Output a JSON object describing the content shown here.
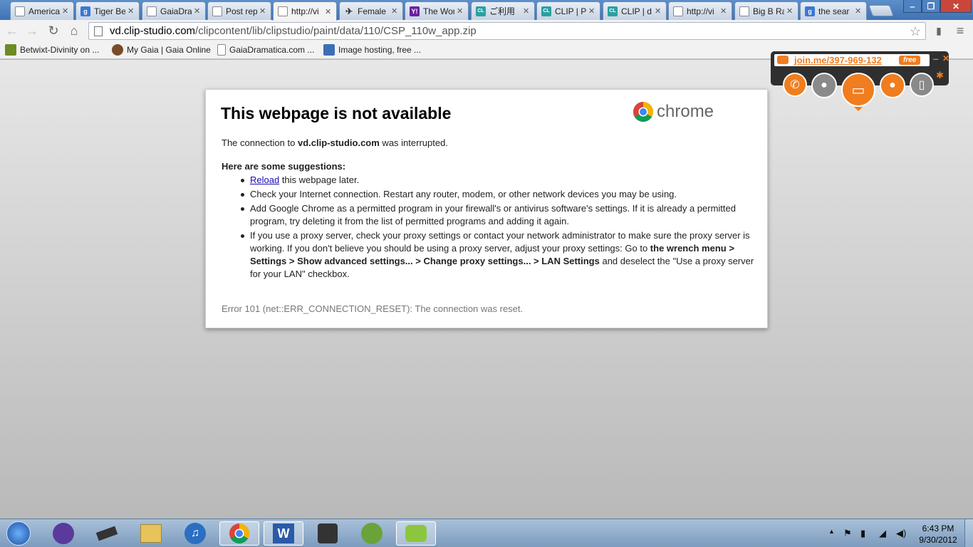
{
  "tabs": [
    {
      "title": "America",
      "icon": "document-icon"
    },
    {
      "title": "Tiger Be",
      "icon": "google-icon"
    },
    {
      "title": "GaiaDrai",
      "icon": "document-icon"
    },
    {
      "title": "Post rep",
      "icon": "document-icon"
    },
    {
      "title": "http://vi",
      "icon": "document-icon",
      "active": true
    },
    {
      "title": "Female",
      "icon": "bird-icon"
    },
    {
      "title": "The Wor",
      "icon": "yahoo-icon"
    },
    {
      "title": "ご利用",
      "icon": "clip-icon"
    },
    {
      "title": "CLIP | Pr",
      "icon": "clip-icon"
    },
    {
      "title": "CLIP | d",
      "icon": "clip-icon"
    },
    {
      "title": "http://vi",
      "icon": "document-icon"
    },
    {
      "title": "Big B Ra",
      "icon": "document-icon"
    },
    {
      "title": "the sear",
      "icon": "google-icon"
    }
  ],
  "address": {
    "prefix": "vd.clip-studio.com",
    "path": "/clipcontent/lib/clipstudio/paint/data/110/CSP_110w_app.zip"
  },
  "bookmarks": [
    {
      "label": "Betwixt-Divinity on ...",
      "icon": "bookmark-site-icon"
    },
    {
      "label": "My Gaia | Gaia Online",
      "icon": "gaia-icon"
    },
    {
      "label": "GaiaDramatica.com ...",
      "icon": "document-icon"
    },
    {
      "label": "Image hosting, free ...",
      "icon": "image-host-icon"
    }
  ],
  "error": {
    "title": "This webpage is not available",
    "logo_word": "chrome",
    "msg_pre": "The connection to ",
    "msg_host": "vd.clip-studio.com",
    "msg_post": " was interrupted.",
    "suggestions_title": "Here are some suggestions:",
    "s1_link": "Reload",
    "s1_rest": " this webpage later.",
    "s2": "Check your Internet connection. Restart any router, modem, or other network devices you may be using.",
    "s3": "Add Google Chrome as a permitted program in your firewall's or antivirus software's settings. If it is already a permitted program, try deleting it from the list of permitted programs and adding it again.",
    "s4_a": "If you use a proxy server, check your proxy settings or contact your network administrator to make sure the proxy server is working. If you don't believe you should be using a proxy server, adjust your proxy settings: Go to ",
    "s4_b": "the wrench menu > Settings > Show advanced settings... > Change proxy settings... > LAN Settings",
    "s4_c": " and deselect the \"Use a proxy server for your LAN\" checkbox.",
    "code": "Error 101 (net::ERR_CONNECTION_RESET): The connection was reset."
  },
  "joinme": {
    "link": "join.me/397-969-132",
    "badge": "free"
  },
  "clock": {
    "time": "6:43 PM",
    "date": "9/30/2012"
  },
  "colors": {
    "joinme_orange": "#f07d1e",
    "link_blue": "#1a0dab",
    "titlebar_blue": "#4a7fbf"
  }
}
